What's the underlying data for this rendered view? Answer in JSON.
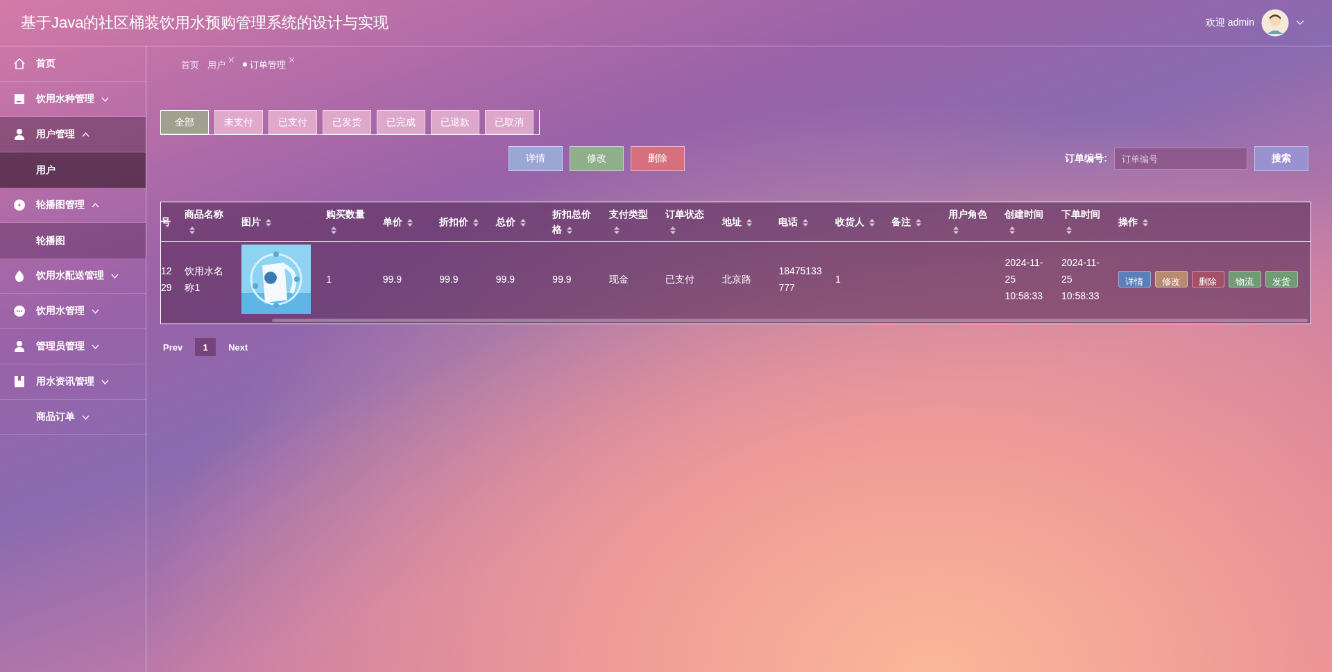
{
  "header": {
    "title": "基于Java的社区桶装饮用水预购管理系统的设计与实现",
    "welcome": "欢迎 admin"
  },
  "sidebar": {
    "items": [
      {
        "label": "首页",
        "selected": false
      },
      {
        "label": "饮用水种管理",
        "selected": false,
        "expanded": false
      },
      {
        "label": "用户管理",
        "selected": true,
        "expanded": true,
        "children": [
          {
            "label": "用户",
            "selected": true
          }
        ]
      },
      {
        "label": "轮播图管理",
        "selected": false,
        "expanded": true,
        "children": [
          {
            "label": "轮播图",
            "selected": false
          }
        ]
      },
      {
        "label": "饮用水配送管理",
        "selected": false,
        "expanded": false
      },
      {
        "label": "饮用水管理",
        "selected": false,
        "expanded": false
      },
      {
        "label": "管理员管理",
        "selected": false,
        "expanded": false
      },
      {
        "label": "用水资讯管理",
        "selected": false,
        "expanded": false
      },
      {
        "label": "商品订单",
        "selected": false,
        "expanded": false
      }
    ]
  },
  "breadcrumb_tabs": [
    {
      "label": "首页",
      "closable": false,
      "selected": false
    },
    {
      "label": "用户",
      "closable": true,
      "selected": false
    },
    {
      "label": "订单管理",
      "closable": true,
      "selected": true
    }
  ],
  "status_tabs": [
    {
      "label": "全部",
      "selected": true
    },
    {
      "label": "未支付",
      "selected": false
    },
    {
      "label": "已支付",
      "selected": false
    },
    {
      "label": "已发货",
      "selected": false
    },
    {
      "label": "已完成",
      "selected": false
    },
    {
      "label": "已退款",
      "selected": false
    },
    {
      "label": "已取消",
      "selected": false
    }
  ],
  "toolbar": [
    {
      "label": "详情",
      "color": "#9aa6d6"
    },
    {
      "label": "修改",
      "color": "#8fae8a"
    },
    {
      "label": "删除",
      "color": "#d6707e"
    }
  ],
  "search": {
    "label": "订单编号:",
    "placeholder": "订单编号",
    "button": "搜索"
  },
  "table": {
    "columns": [
      {
        "label": "号",
        "sortable": false
      },
      {
        "label": "商品名称",
        "sortable": true
      },
      {
        "label": "图片",
        "sortable": true
      },
      {
        "label": "购买数量",
        "sortable": true
      },
      {
        "label": "单价",
        "sortable": true
      },
      {
        "label": "折扣价",
        "sortable": true
      },
      {
        "label": "总价",
        "sortable": true
      },
      {
        "label": "折扣总价格",
        "sortable": true
      },
      {
        "label": "支付类型",
        "sortable": true
      },
      {
        "label": "订单状态",
        "sortable": true
      },
      {
        "label": "地址",
        "sortable": true
      },
      {
        "label": "电话",
        "sortable": true
      },
      {
        "label": "收货人",
        "sortable": true
      },
      {
        "label": "备注",
        "sortable": true
      },
      {
        "label": "用户角色",
        "sortable": true
      },
      {
        "label": "创建时间",
        "sortable": true
      },
      {
        "label": "下单时间",
        "sortable": true
      },
      {
        "label": "操作",
        "sortable": true
      }
    ],
    "rows": [
      {
        "cells": [
          "1229",
          "饮用水名称1",
          {
            "kind": "picture"
          },
          "1",
          "99.9",
          "99.9",
          "99.9",
          "99.9",
          "现金",
          "已支付",
          "北京路",
          "18475133777",
          "1",
          "",
          "",
          "2024-11-25 10:58:33",
          "2024-11-25 10:58:33"
        ],
        "actions": [
          {
            "label": "详情",
            "color": "#5b7fb8"
          },
          {
            "label": "修改",
            "color": "#b98a70"
          },
          {
            "label": "删除",
            "color": "#a35068"
          },
          {
            "label": "物流",
            "color": "#6f9c74"
          },
          {
            "label": "发货",
            "color": "#6f9c74"
          }
        ]
      }
    ]
  },
  "pagination": {
    "prev": "Prev",
    "pages": [
      {
        "label": "1",
        "selected": true
      }
    ],
    "next": "Next"
  }
}
